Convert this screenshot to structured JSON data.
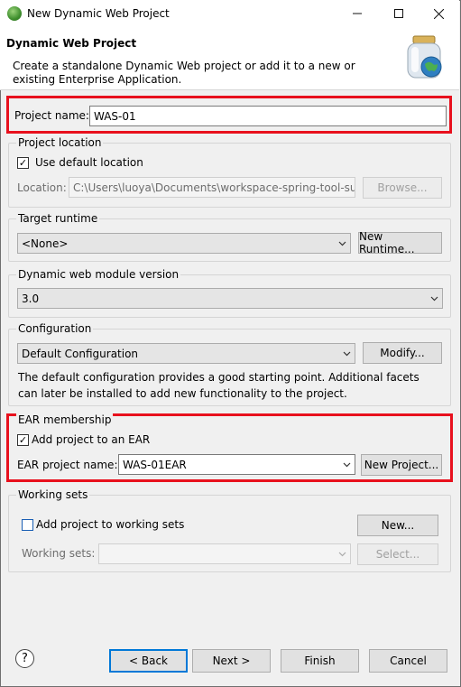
{
  "window": {
    "title": "New Dynamic Web Project"
  },
  "header": {
    "title": "Dynamic Web Project",
    "description": "Create a standalone Dynamic Web project or add it to a new or existing Enterprise Application."
  },
  "project_name": {
    "label": "Project name:",
    "value": "WAS-01"
  },
  "project_location": {
    "legend": "Project location",
    "use_default_label": "Use default location",
    "use_default_checked": true,
    "location_label": "Location:",
    "location_value": "C:\\Users\\luoya\\Documents\\workspace-spring-tool-su",
    "browse_label": "Browse..."
  },
  "target_runtime": {
    "legend": "Target runtime",
    "selected": "<None>",
    "new_runtime_label": "New Runtime..."
  },
  "module_version": {
    "legend": "Dynamic web module version",
    "selected": "3.0"
  },
  "configuration": {
    "legend": "Configuration",
    "selected": "Default Configuration",
    "modify_label": "Modify...",
    "description": "The default configuration provides a good starting point. Additional facets can later be installed to add new functionality to the project."
  },
  "ear": {
    "legend": "EAR membership",
    "add_label": "Add project to an EAR",
    "add_checked": true,
    "name_label": "EAR project name:",
    "name_value": "WAS-01EAR",
    "new_project_label": "New Project..."
  },
  "working_sets": {
    "legend": "Working sets",
    "add_label": "Add project to working sets",
    "add_checked": false,
    "new_label": "New...",
    "sets_label": "Working sets:",
    "select_label": "Select..."
  },
  "footer": {
    "help": "?",
    "back_label": "< Back",
    "next_label": "Next >",
    "finish_label": "Finish",
    "cancel_label": "Cancel"
  },
  "colors": {
    "highlight": "#e8101d",
    "accent": "#0078d7"
  }
}
